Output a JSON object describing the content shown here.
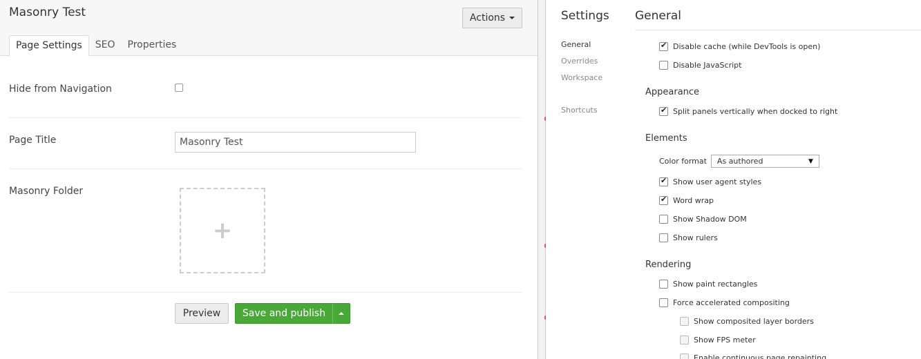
{
  "cms": {
    "page_name": "Masonry Test",
    "actions_label": "Actions",
    "tabs": [
      {
        "label": "Page Settings",
        "active": true
      },
      {
        "label": "SEO",
        "active": false
      },
      {
        "label": "Properties",
        "active": false
      }
    ],
    "fields": {
      "hide_nav_label": "Hide from Navigation",
      "hide_nav_checked": false,
      "page_title_label": "Page Title",
      "page_title_value": "Masonry Test",
      "folder_label": "Masonry Folder",
      "folder_icon": "plus-icon"
    },
    "buttons": {
      "preview": "Preview",
      "save": "Save and publish"
    },
    "colors": {
      "save_green": "#4aa838"
    }
  },
  "devtools": {
    "title": "Settings",
    "section": "General",
    "nav": [
      {
        "label": "General",
        "active": true
      },
      {
        "label": "Overrides",
        "active": false
      },
      {
        "label": "Workspace",
        "active": false
      },
      {
        "label": "Shortcuts",
        "active": false
      }
    ],
    "general": [
      {
        "label": "Disable cache (while DevTools is open)",
        "checked": true
      },
      {
        "label": "Disable JavaScript",
        "checked": false
      }
    ],
    "appearance": {
      "title": "Appearance",
      "options": [
        {
          "label": "Split panels vertically when docked to right",
          "checked": true
        }
      ]
    },
    "elements": {
      "title": "Elements",
      "color_format_label": "Color format",
      "color_format_value": "As authored",
      "options": [
        {
          "label": "Show user agent styles",
          "checked": true
        },
        {
          "label": "Word wrap",
          "checked": true
        },
        {
          "label": "Show Shadow DOM",
          "checked": false
        },
        {
          "label": "Show rulers",
          "checked": false
        }
      ]
    },
    "rendering": {
      "title": "Rendering",
      "options": [
        {
          "label": "Show paint rectangles",
          "checked": false
        },
        {
          "label": "Force accelerated compositing",
          "checked": false
        }
      ],
      "sub_options": [
        {
          "label": "Show composited layer borders",
          "checked": false
        },
        {
          "label": "Show FPS meter",
          "checked": false
        },
        {
          "label": "Enable continuous page repainting",
          "checked": false
        }
      ]
    }
  }
}
